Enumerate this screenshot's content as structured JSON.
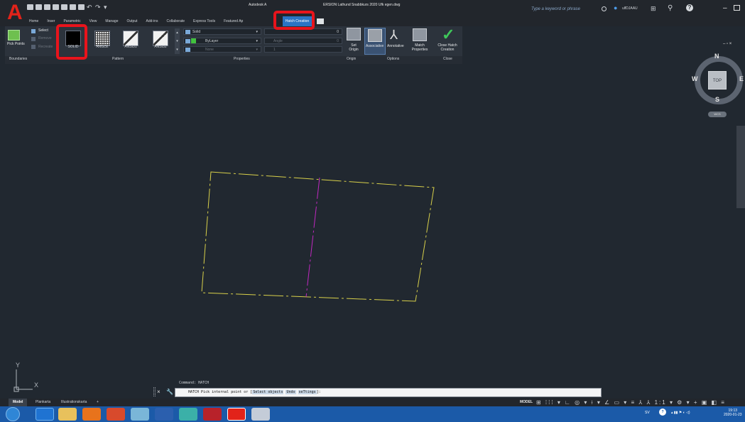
{
  "titlebar": {
    "title": "Autodesk A",
    "title_file": "ERSION   Lathund Snabbkurs 2020 Ufk egen.dwg",
    "search_placeholder": "Type a keyword or phrase",
    "user_name": "ulfDJAAU"
  },
  "tabs": [
    {
      "label": "Home"
    },
    {
      "label": "Inser"
    },
    {
      "label": "Parametric"
    },
    {
      "label": "View"
    },
    {
      "label": "Manage"
    },
    {
      "label": "Output"
    },
    {
      "label": "Add-ins"
    },
    {
      "label": "Collaborate"
    },
    {
      "label": "Express Tools"
    },
    {
      "label": "Featured Ap"
    }
  ],
  "context_tab": {
    "label": "Hatch Creation"
  },
  "ribbon": {
    "pick_points": "Pick Points",
    "select": "Select",
    "remove": "Remove",
    "recreate": "Recreate",
    "patterns": [
      {
        "label": "SOLID"
      },
      {
        "label": "ANGLE"
      },
      {
        "label": "ANSI31"
      },
      {
        "label": "ANSI32"
      }
    ],
    "prop_type": "Solid",
    "prop_color": "ByLayer",
    "prop_bg": "None",
    "transparency_value": "0",
    "angle_label": "Angle",
    "angle_value": "0",
    "scale_value": "1",
    "set_origin": "Set Origin",
    "associative": "Associative",
    "annotative": "Annotative",
    "match_properties": "Match Properties",
    "close_hatch": "Close Hatch Creation",
    "panels": {
      "boundaries": "Boundaries",
      "pattern": "Pattern",
      "properties": "Properties",
      "origin": "Origin",
      "options": "Options",
      "close": "Close"
    }
  },
  "viewcube": {
    "north": "N",
    "south": "S",
    "east": "E",
    "west": "W",
    "top": "TOP",
    "wcs": "WCS"
  },
  "ucs": {
    "y": "Y",
    "x": "X"
  },
  "command": {
    "history": "Command: HATCH",
    "prompt_prefix": "HATCH Pick internal point or [",
    "opt_select": "Select objects",
    "opt_undo": "Undo",
    "opt_settings": "seTtings",
    "prompt_suffix": "]:"
  },
  "layout_tabs": [
    {
      "label": "Model"
    },
    {
      "label": "Plankarta"
    },
    {
      "label": "Illustrationskarta"
    }
  ],
  "status": {
    "model": "MODEL",
    "scale": "1:1"
  },
  "tray": {
    "lang": "SV",
    "time": "19:13",
    "date": "2020-01-23"
  },
  "colors": {
    "highlight": "#e8141c",
    "hatch_tab": "#2a74c4",
    "drawing_lines": "#d8d04a",
    "center_line": "#c028c0",
    "canvas_bg": "#212830"
  }
}
